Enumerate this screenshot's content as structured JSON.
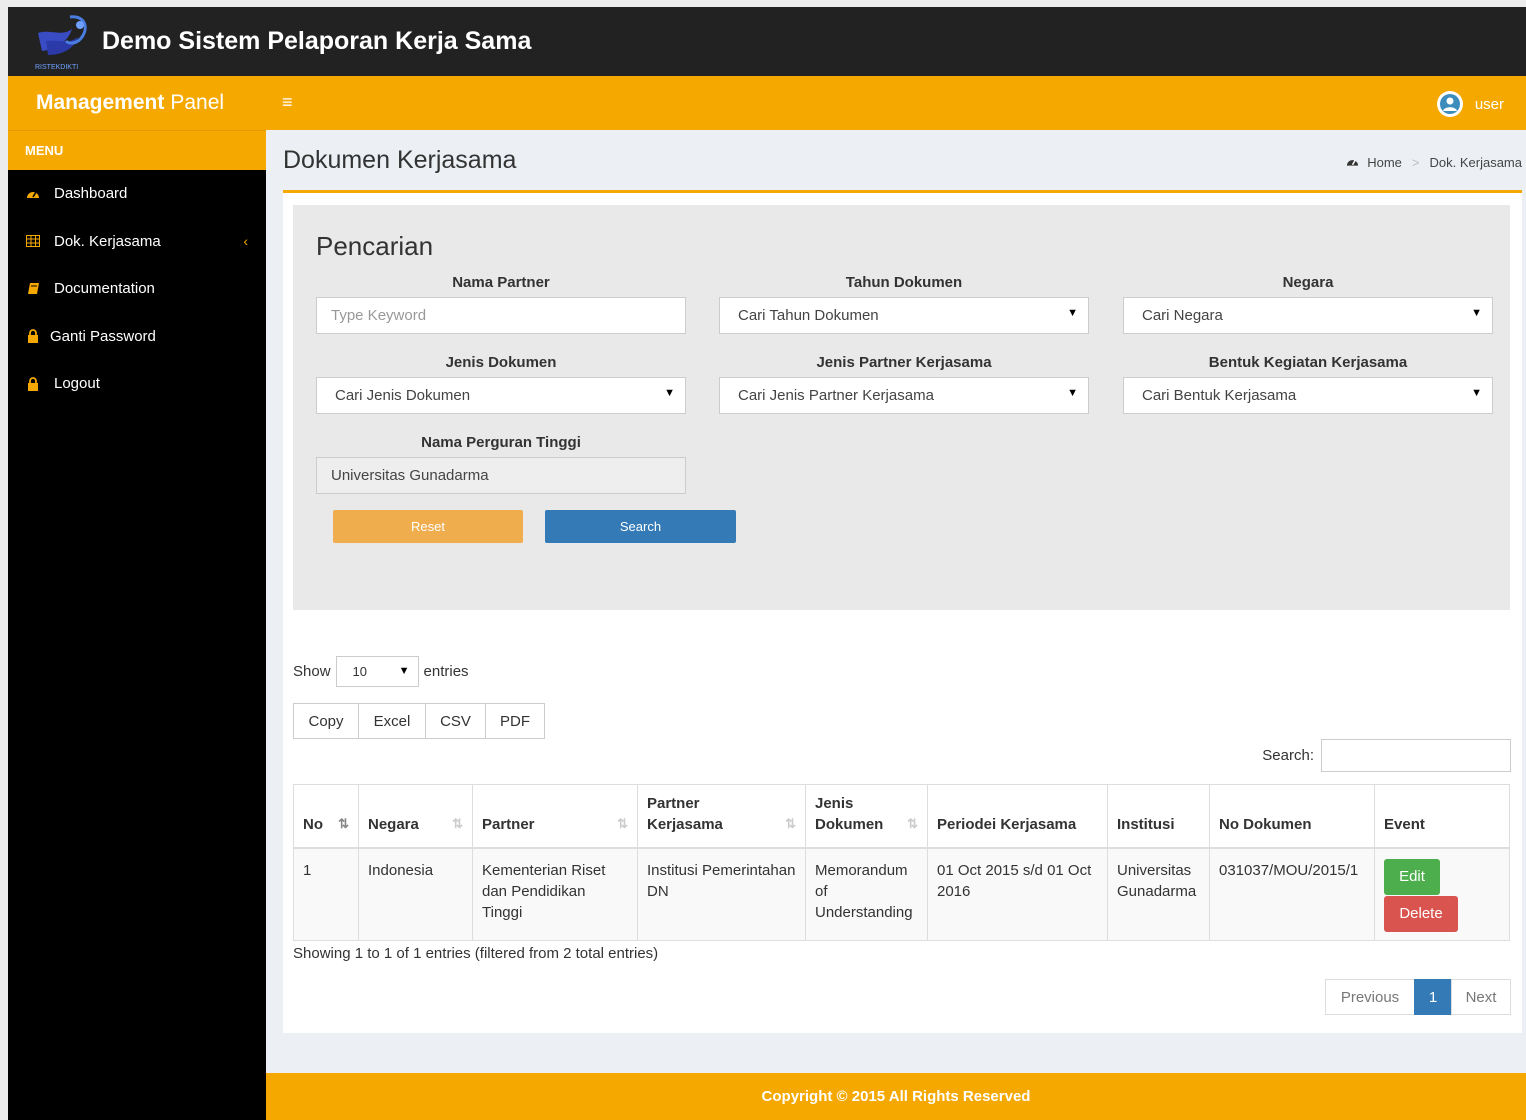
{
  "app": {
    "title": "Demo Sistem Pelaporan Kerja Sama",
    "logo_text": "RISTEKDIKTI"
  },
  "brand": {
    "bold": "Management",
    "rest": "Panel"
  },
  "sidebar": {
    "header": "MENU",
    "items": [
      {
        "label": "Dashboard",
        "icon": "dashboard-icon"
      },
      {
        "label": "Dok. Kerjasama",
        "icon": "table-icon"
      },
      {
        "label": "Documentation",
        "icon": "book-icon"
      },
      {
        "label": "Ganti Password",
        "icon": "lock-icon"
      },
      {
        "label": "Logout",
        "icon": "lock-icon"
      }
    ]
  },
  "navbar": {
    "user": "user"
  },
  "page": {
    "title": "Dokumen Kerjasama",
    "breadcrumb": {
      "home": "Home",
      "current": "Dok. Kerjasama"
    }
  },
  "search": {
    "heading": "Pencarian",
    "nama_partner": {
      "label": "Nama Partner",
      "placeholder": "Type Keyword"
    },
    "tahun_dokumen": {
      "label": "Tahun Dokumen",
      "value": "Cari Tahun Dokumen"
    },
    "negara": {
      "label": "Negara",
      "value": "Cari Negara"
    },
    "jenis_dokumen": {
      "label": "Jenis Dokumen",
      "value": "Cari Jenis Dokumen"
    },
    "jenis_partner": {
      "label": "Jenis Partner Kerjasama",
      "value": "Cari Jenis Partner Kerjasama"
    },
    "bentuk_kegiatan": {
      "label": "Bentuk Kegiatan Kerjasama",
      "value": "Cari Bentuk Kerjasama"
    },
    "perguruan_tinggi": {
      "label": "Nama Perguran Tinggi",
      "value": "Universitas Gunadarma"
    },
    "reset_label": "Reset",
    "search_label": "Search"
  },
  "datatable": {
    "show": "Show",
    "entries_value": "10",
    "entries": "entries",
    "buttons": [
      "Copy",
      "Excel",
      "CSV",
      "PDF"
    ],
    "search_label": "Search:",
    "columns": [
      "No",
      "Negara",
      "Partner",
      "Partner Kerjasama",
      "Jenis Dokumen",
      "Periodei Kerjasama",
      "Institusi",
      "No Dokumen",
      "Event"
    ],
    "rows": [
      {
        "no": "1",
        "negara": "Indonesia",
        "partner": "Kementerian Riset dan Pendidikan Tinggi",
        "partner_kerjasama": "Institusi Pemerintahan DN",
        "jenis_dokumen": "Memorandum of Understanding",
        "periode": "01 Oct 2015 s/d 01 Oct 2016",
        "institusi": "Universitas Gunadarma",
        "no_dokumen": "031037/MOU/2015/1",
        "edit_label": "Edit",
        "delete_label": "Delete"
      }
    ],
    "info": "Showing 1 to 1 of 1 entries (filtered from 2 total entries)",
    "pager": {
      "previous": "Previous",
      "current": "1",
      "next": "Next"
    }
  },
  "footer": {
    "text": "Copyright © 2015 All Rights Reserved"
  },
  "colors": {
    "accent": "#f5a800",
    "topbar": "#222222",
    "sidebar": "#000000",
    "primary": "#337ab7",
    "warning": "#f0ad4e",
    "success": "#4cae4c",
    "danger": "#d9534f"
  }
}
